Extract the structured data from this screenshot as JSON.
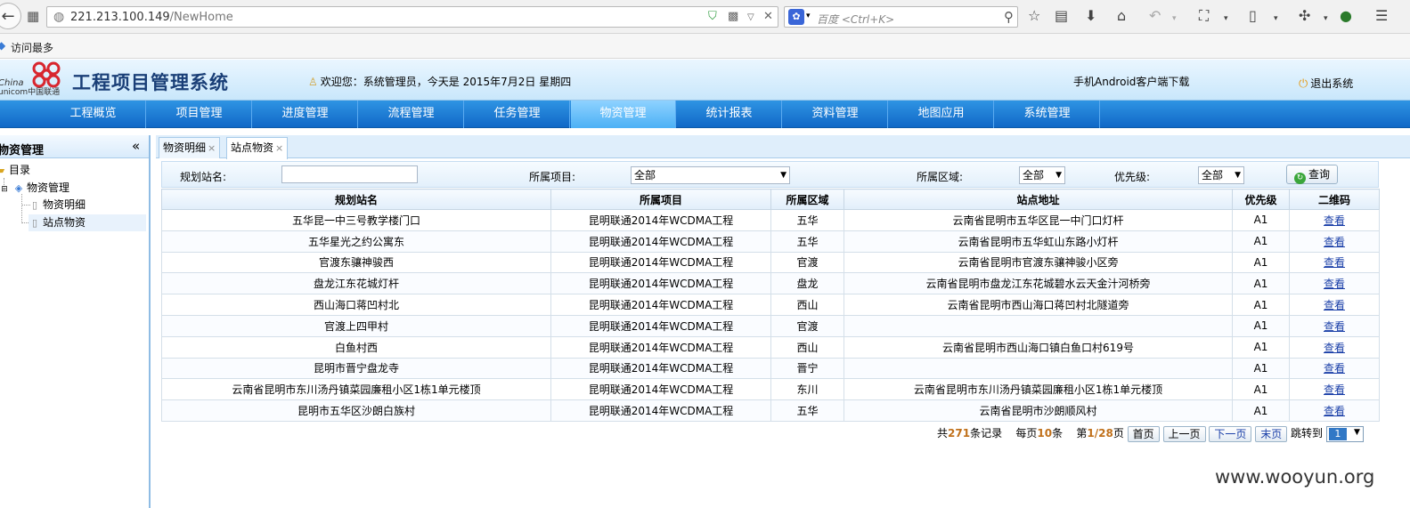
{
  "browser": {
    "url_host": "221.213.100.149",
    "url_path": "/NewHome",
    "search_placeholder": "百度 <Ctrl+K>",
    "bookmarks": [
      {
        "label": "访问最多"
      }
    ]
  },
  "header": {
    "logo_en_1": "China",
    "logo_en_2": "unicom中国联通",
    "app_title": "工程项目管理系统",
    "welcome_text": "欢迎您：系统管理员，今天是 2015年7月2日 星期四",
    "android_download": "手机Android客户端下载",
    "logout": "退出系统",
    "colors": {
      "title": "#1a3f77",
      "nav": "#1a78d4",
      "nav_active": "#6cc3ff"
    }
  },
  "nav": {
    "items": [
      {
        "label": "工程概览"
      },
      {
        "label": "项目管理"
      },
      {
        "label": "进度管理"
      },
      {
        "label": "流程管理"
      },
      {
        "label": "任务管理"
      },
      {
        "label": "物资管理"
      },
      {
        "label": "统计报表"
      },
      {
        "label": "资料管理"
      },
      {
        "label": "地图应用"
      },
      {
        "label": "系统管理"
      }
    ],
    "active_index": 5
  },
  "sidebar": {
    "title": "物资管理",
    "collapse_icon": "double-chevron-left-icon",
    "tree": [
      {
        "label": "目录",
        "icon": "folder-icon"
      },
      {
        "label": "物资管理",
        "icon": "book-icon"
      },
      {
        "label": "物资明细",
        "icon": "document-icon"
      },
      {
        "label": "站点物资",
        "icon": "document-icon"
      }
    ],
    "selected": "站点物资"
  },
  "tabs": [
    {
      "label": "物资明细",
      "close": "×"
    },
    {
      "label": "站点物资",
      "close": "×"
    }
  ],
  "filters": {
    "station_label": "规划站名:",
    "station_value": "",
    "project_label": "所属项目:",
    "project_value": "全部",
    "region_label": "所属区域:",
    "region_value": "全部",
    "priority_label": "优先级:",
    "priority_value": "全部",
    "query_label": "查询"
  },
  "table": {
    "columns": [
      "规划站名",
      "所属项目",
      "所属区域",
      "站点地址",
      "优先级",
      "二维码"
    ],
    "rows": [
      [
        "五华昆一中三号教学楼门口",
        "昆明联通2014年WCDMA工程",
        "五华",
        "云南省昆明市五华区昆一中门口灯杆",
        "A1",
        "查看"
      ],
      [
        "五华星光之约公寓东",
        "昆明联通2014年WCDMA工程",
        "五华",
        "云南省昆明市五华虹山东路小灯杆",
        "A1",
        "查看"
      ],
      [
        "官渡东骧神骏西",
        "昆明联通2014年WCDMA工程",
        "官渡",
        "云南省昆明市官渡东骧神骏小区旁",
        "A1",
        "查看"
      ],
      [
        "盘龙江东花城灯杆",
        "昆明联通2014年WCDMA工程",
        "盘龙",
        "云南省昆明市盘龙江东花城碧水云天金汁河桥旁",
        "A1",
        "查看"
      ],
      [
        "西山海口蒋凹村北",
        "昆明联通2014年WCDMA工程",
        "西山",
        "云南省昆明市西山海口蒋凹村北隧道旁",
        "A1",
        "查看"
      ],
      [
        "官渡上四甲村",
        "昆明联通2014年WCDMA工程",
        "官渡",
        "",
        "A1",
        "查看"
      ],
      [
        "白鱼村西",
        "昆明联通2014年WCDMA工程",
        "西山",
        "云南省昆明市西山海口镇白鱼口村619号",
        "A1",
        "查看"
      ],
      [
        "昆明市晋宁盘龙寺",
        "昆明联通2014年WCDMA工程",
        "晋宁",
        "",
        "A1",
        "查看"
      ],
      [
        "云南省昆明市东川汤丹镇菜园廉租小区1栋1单元楼顶",
        "昆明联通2014年WCDMA工程",
        "东川",
        "云南省昆明市东川汤丹镇菜园廉租小区1栋1单元楼顶",
        "A1",
        "查看"
      ],
      [
        "昆明市五华区沙朗白族村",
        "昆明联通2014年WCDMA工程",
        "五华",
        "云南省昆明市沙朗顺风村",
        "A1",
        "查看"
      ]
    ]
  },
  "pager": {
    "total_prefix": "共",
    "total": "271",
    "total_suffix": "条记录",
    "per_page_prefix": "每页",
    "per_page": "10",
    "per_page_suffix": "条",
    "page_prefix": "第",
    "page": "1/28",
    "page_suffix": "页",
    "first": "首页",
    "prev": "上一页",
    "next": "下一页",
    "last": "末页",
    "jump_label": "跳转到",
    "jump_value": "1"
  },
  "watermark": "www.wooyun.org"
}
